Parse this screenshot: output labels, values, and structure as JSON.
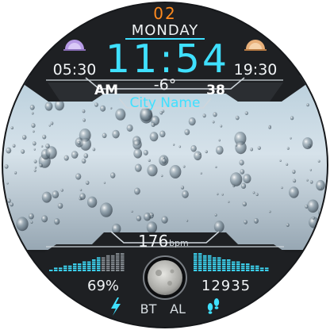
{
  "date": {
    "day_number": "02",
    "weekday": "MONDAY"
  },
  "time": {
    "main": "11:54",
    "ampm": "AM"
  },
  "sun": {
    "sunrise": "05:30",
    "sunset": "19:30"
  },
  "weather": {
    "temperature": "-6°",
    "humidity": "38"
  },
  "location": {
    "city": "City Name"
  },
  "health": {
    "heart_rate": "176",
    "heart_rate_unit": "bpm",
    "battery": "69%",
    "steps": "12935"
  },
  "status": {
    "bt": "BT",
    "alarm": "AL"
  },
  "icons": {
    "sunrise": "sunrise-icon",
    "sunset": "sunset-icon",
    "moon": "moon-phase-icon",
    "battery_bolt": "lightning-icon",
    "steps": "footsteps-icon"
  },
  "colors": {
    "accent_cyan": "#3fe0ff",
    "accent_orange": "#ff8a1e",
    "bezel": "#1a1c1f"
  }
}
